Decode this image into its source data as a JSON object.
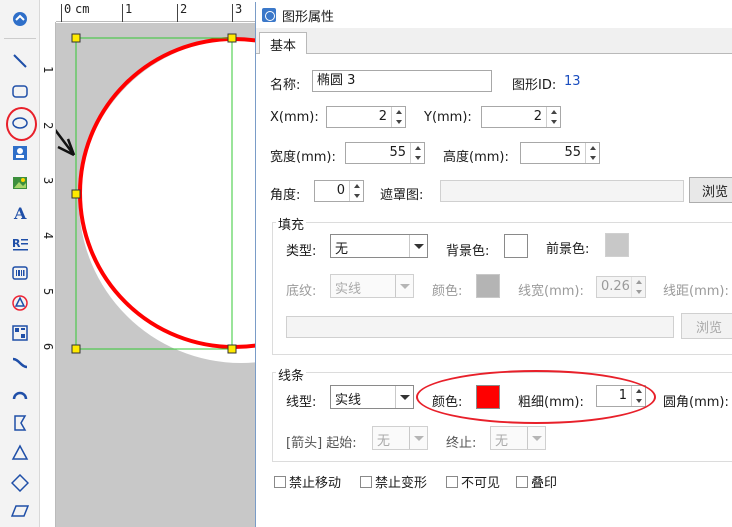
{
  "dialog": {
    "title": "图形属性",
    "tab_basic": "基本"
  },
  "ruler": {
    "unit": "cm",
    "top_numbers": [
      "0",
      "1",
      "2",
      "3"
    ],
    "left_numbers": [
      "1",
      "2",
      "3",
      "4",
      "5",
      "6"
    ]
  },
  "basic": {
    "name_label": "名称:",
    "name_value": "椭圆 3",
    "id_label": "图形ID:",
    "id_value": "13",
    "x_label": "X(mm):",
    "x_value": "2",
    "y_label": "Y(mm):",
    "y_value": "2",
    "width_label": "宽度(mm):",
    "width_value": "55",
    "height_label": "高度(mm):",
    "height_value": "55",
    "angle_label": "角度:",
    "angle_value": "0",
    "mask_label": "遮罩图:",
    "browse_label": "浏览"
  },
  "fill": {
    "group_label": "填充",
    "type_label": "类型:",
    "type_value": "无",
    "bg_color_label": "背景色:",
    "bg_color": "#ffffff",
    "fg_color_label": "前景色:",
    "fg_color": "#c8c8c8",
    "pattern_label": "底纹:",
    "pattern_value": "实线",
    "color_label": "颜色:",
    "color": "#b4b4b4",
    "line_width_label": "线宽(mm):",
    "line_width_value": "0.26",
    "line_spacing_label": "线距(mm):",
    "browse_label": "浏览"
  },
  "stroke": {
    "group_label": "线条",
    "line_type_label": "线型:",
    "line_type_value": "实线",
    "color_label": "颜色:",
    "color": "#ff0000",
    "thickness_label": "粗细(mm):",
    "thickness_value": "1",
    "corner_label": "圆角(mm):",
    "arrow_label": "[箭头] 起始:",
    "arrow_start_value": "无",
    "arrow_end_label": "终止:",
    "arrow_end_value": "无"
  },
  "options": {
    "lock_move": "禁止移动",
    "lock_resize": "禁止变形",
    "invisible": "不可见",
    "overprint": "叠印"
  },
  "tools": [
    "select-icon",
    "line-icon",
    "rounded-rect-icon",
    "ellipse-icon",
    "image-edit-icon",
    "picture-icon",
    "text-icon",
    "richtext-icon",
    "barcode-icon",
    "qrcode-icon",
    "table-icon",
    "curve-icon",
    "arc-icon",
    "flag-icon",
    "triangle-icon",
    "diamond-icon",
    "parallelogram-icon"
  ]
}
